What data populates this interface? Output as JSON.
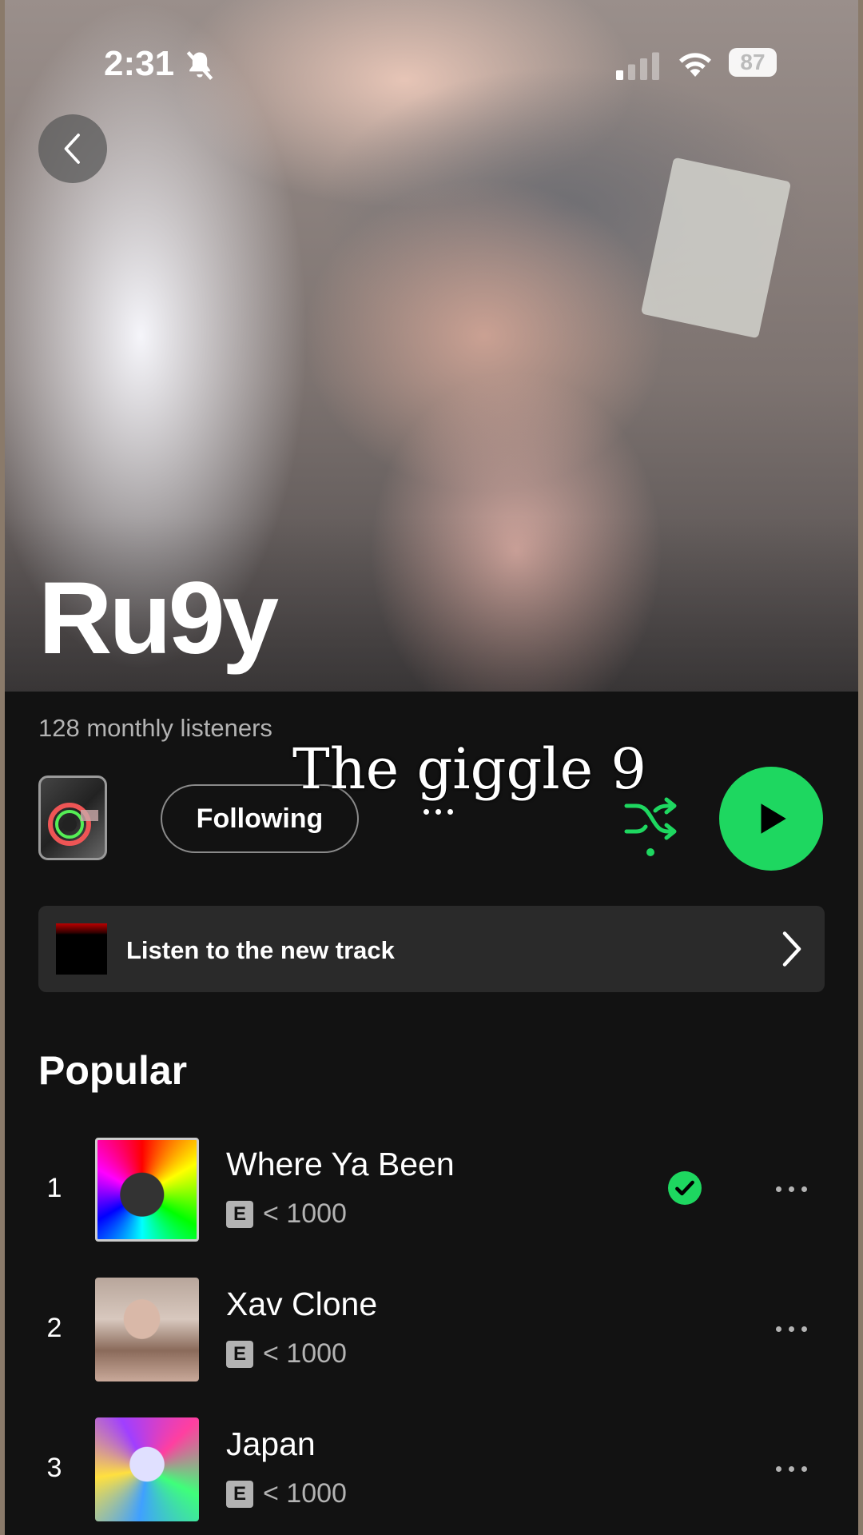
{
  "status_bar": {
    "time": "2:31",
    "battery": "87",
    "icons": [
      "bell-slash-icon",
      "signal-icon",
      "wifi-icon"
    ]
  },
  "header": {
    "artist_name": "Ru9y",
    "back_icon": "chevron-left-icon"
  },
  "artist": {
    "monthly_listeners": "128 monthly listeners",
    "follow_label": "Following",
    "overlay_caption": "The giggle 9"
  },
  "new_track": {
    "label": "Listen to the new track"
  },
  "popular": {
    "heading": "Popular",
    "tracks": [
      {
        "number": "1",
        "title": "Where Ya Been",
        "explicit": "E",
        "plays": "< 1000",
        "saved": true
      },
      {
        "number": "2",
        "title": "Xav Clone",
        "explicit": "E",
        "plays": "< 1000",
        "saved": false
      },
      {
        "number": "3",
        "title": "Japan",
        "explicit": "E",
        "plays": "< 1000",
        "saved": false
      }
    ]
  },
  "colors": {
    "accent": "#1ed760",
    "background": "#121212",
    "card": "#2a2a2a",
    "secondary_text": "#b3b3b3"
  }
}
